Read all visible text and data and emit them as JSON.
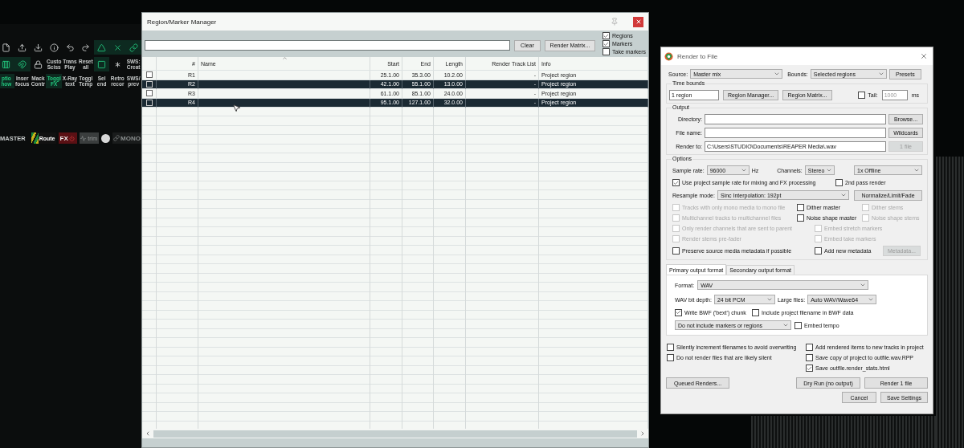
{
  "toolbar": {
    "rows": [
      [
        {
          "kind": "icon",
          "on": false
        },
        {
          "kind": "icon",
          "on": false
        },
        {
          "kind": "icon",
          "on": false
        },
        {
          "kind": "icon",
          "on": false
        },
        {
          "kind": "icon",
          "on": false
        },
        {
          "kind": "icon",
          "on": false
        },
        {
          "kind": "icon",
          "on": true
        },
        {
          "kind": "icon",
          "on": true
        },
        {
          "kind": "icon",
          "on": true
        }
      ],
      [
        {
          "kind": "icon",
          "on": true
        },
        {
          "kind": "icon",
          "on": true
        },
        {
          "kind": "icon",
          "on": false
        },
        {
          "kind": "label",
          "lines": [
            "Custo",
            "Sciss"
          ],
          "on": false
        },
        {
          "kind": "label",
          "lines": [
            "Trans",
            "Play"
          ],
          "on": false
        },
        {
          "kind": "label",
          "lines": [
            "Reset",
            "all"
          ],
          "on": false
        },
        {
          "kind": "icon",
          "on": true
        },
        {
          "kind": "icon",
          "on": false
        },
        {
          "kind": "label",
          "lines": [
            "SWS:",
            "Creat"
          ],
          "on": false
        }
      ],
      [
        {
          "kind": "label",
          "lines": [
            "ptio",
            "how"
          ],
          "on": true
        },
        {
          "kind": "label",
          "lines": [
            "Inser",
            "focus"
          ],
          "on": false
        },
        {
          "kind": "label",
          "lines": [
            "Mack",
            "Contr"
          ],
          "on": false
        },
        {
          "kind": "label",
          "lines": [
            "Toggl",
            "FX"
          ],
          "on": true
        },
        {
          "kind": "label",
          "lines": [
            "X-Ray",
            "text"
          ],
          "on": false
        },
        {
          "kind": "label",
          "lines": [
            "Toggl",
            "Temp"
          ],
          "on": false
        },
        {
          "kind": "label",
          "lines": [
            "Sel",
            "end"
          ],
          "on": false
        },
        {
          "kind": "label",
          "lines": [
            "Retro",
            "recor"
          ],
          "on": false
        },
        {
          "kind": "label",
          "lines": [
            "SWS/",
            "prev"
          ],
          "on": false
        }
      ]
    ]
  },
  "mixer": {
    "name": "MASTER",
    "route": "Route",
    "fx": "FX",
    "trim": "trim",
    "mono": "MONO"
  },
  "region_manager": {
    "title": "Region/Marker Manager",
    "buttons": [
      "Clear",
      "Render Matrix..."
    ],
    "filters": [
      {
        "label": "Regions",
        "checked": true
      },
      {
        "label": "Markers",
        "checked": true
      },
      {
        "label": "Take markers",
        "checked": false
      }
    ],
    "columns": [
      "#",
      "Name",
      "Start",
      "End",
      "Length",
      "Render Track List",
      "Info"
    ],
    "rows": [
      {
        "number": "R1",
        "start": "25.1.00",
        "end": "35.3.00",
        "length": "10.2.00",
        "render_track_list": "-",
        "info": "Project region",
        "checked": false,
        "selected": false
      },
      {
        "number": "R2",
        "start": "42.1.00",
        "end": "55.1.00",
        "length": "13.0.00",
        "render_track_list": "-",
        "info": "Project region",
        "checked": false,
        "selected": true
      },
      {
        "number": "R3",
        "start": "61.1.00",
        "end": "85.1.00",
        "length": "24.0.00",
        "render_track_list": "-",
        "info": "Project region",
        "checked": false,
        "selected": false
      },
      {
        "number": "R4",
        "start": "95.1.00",
        "end": "127.1.00",
        "length": "32.0.00",
        "render_track_list": "-",
        "info": "Project region",
        "checked": false,
        "selected": true
      }
    ]
  },
  "render": {
    "title": "Render to File",
    "source": {
      "label": "Source:",
      "value": "Master mix"
    },
    "bounds": {
      "label": "Bounds:",
      "value": "Selected regions"
    },
    "presets_button": "Presets",
    "time_bounds": {
      "legend": "Time bounds",
      "value": "1 region",
      "buttons": [
        "Region Manager...",
        "Region Matrix..."
      ],
      "tail": {
        "label": "Tail:",
        "checked": false
      },
      "tail_value": "1000",
      "tail_unit": "ms"
    },
    "output": {
      "legend": "Output",
      "fields": [
        {
          "label": "Directory:",
          "button": "Browse...",
          "button_disabled": false
        },
        {
          "label": "File name:",
          "button": "Wildcards",
          "button_disabled": false
        },
        {
          "label": "Render to:",
          "value": "C:\\Users\\STUDIO\\Documents\\REAPER Media\\.wav",
          "button": "1 file",
          "button_disabled": true
        }
      ]
    },
    "options": {
      "legend": "Options",
      "sample_rate": {
        "label": "Sample rate:",
        "value": "96000",
        "unit": "Hz"
      },
      "channels": {
        "label": "Channels:",
        "value": "Stereo"
      },
      "speed": "1x Offline",
      "project_rate": {
        "label": "Use project sample rate for mixing and FX processing",
        "checked": true
      },
      "second_pass": {
        "label": "2nd pass render",
        "checked": false
      },
      "resample": {
        "label": "Resample mode:",
        "value": "Sinc Interpolation: 192pt"
      },
      "normalize_button": "Normalize/Limit/Fade",
      "stem_rows": [
        [
          {
            "label": "Tracks with only mono media to mono file",
            "checked": false,
            "disabled": true
          },
          {
            "label": "Dither master",
            "checked": false,
            "disabled": false
          },
          {
            "label": "Dither stems",
            "checked": false,
            "disabled": true
          }
        ],
        [
          {
            "label": "Multichannel tracks to multichannel files",
            "checked": false,
            "disabled": true
          },
          {
            "label": "Noise shape master",
            "checked": false,
            "disabled": false
          },
          {
            "label": "Noise shape stems",
            "checked": false,
            "disabled": true
          }
        ]
      ],
      "embed_rows": [
        [
          {
            "label": "Only render channels that are sent to parent",
            "checked": false,
            "disabled": true
          },
          {
            "label": "Embed stretch markers",
            "checked": false,
            "disabled": true
          }
        ],
        [
          {
            "label": "Render stems pre-fader",
            "checked": false,
            "disabled": true
          },
          {
            "label": "Embed take markers",
            "checked": false,
            "disabled": true
          }
        ],
        [
          {
            "label": "Preserve source media metadata if possible",
            "checked": false,
            "disabled": false
          },
          {
            "label": "Add new metadata",
            "checked": false,
            "disabled": false
          }
        ]
      ],
      "metadata_button": "Metadata...",
      "metadata_disabled": true
    },
    "format_tabs": [
      {
        "label": "Primary output format",
        "selected": true
      },
      {
        "label": "Secondary output format",
        "selected": false
      }
    ],
    "format": {
      "label": "Format:",
      "value": "WAV"
    },
    "bit_depth": {
      "label": "WAV bit depth:",
      "value": "24 bit PCM"
    },
    "large_files": {
      "label": "Large files:",
      "value": "Auto WAV/Wave64"
    },
    "bwf": {
      "label": "Write BWF ('bext') chunk",
      "checked": true
    },
    "include_filename": {
      "label": "Include project filename in BWF data",
      "checked": false
    },
    "markers_mode": "Do not include markers or regions",
    "embed_tempo": {
      "label": "Embed tempo",
      "checked": false
    },
    "left_options": [
      {
        "label": "Silently increment filenames to avoid overwriting",
        "checked": false
      },
      {
        "label": "Do not render files that are likely silent",
        "checked": false
      }
    ],
    "right_options": [
      {
        "label": "Add rendered items to new tracks in project",
        "checked": false
      },
      {
        "label": "Save copy of project to outfile.wav.RPP",
        "checked": false
      },
      {
        "label": "Save outfile.render_stats.html",
        "checked": true
      }
    ],
    "buttons": {
      "queued": "Queued Renders...",
      "dry_run": "Dry Run (no output)",
      "render": "Render 1 file",
      "cancel": "Cancel",
      "save": "Save Settings"
    }
  }
}
